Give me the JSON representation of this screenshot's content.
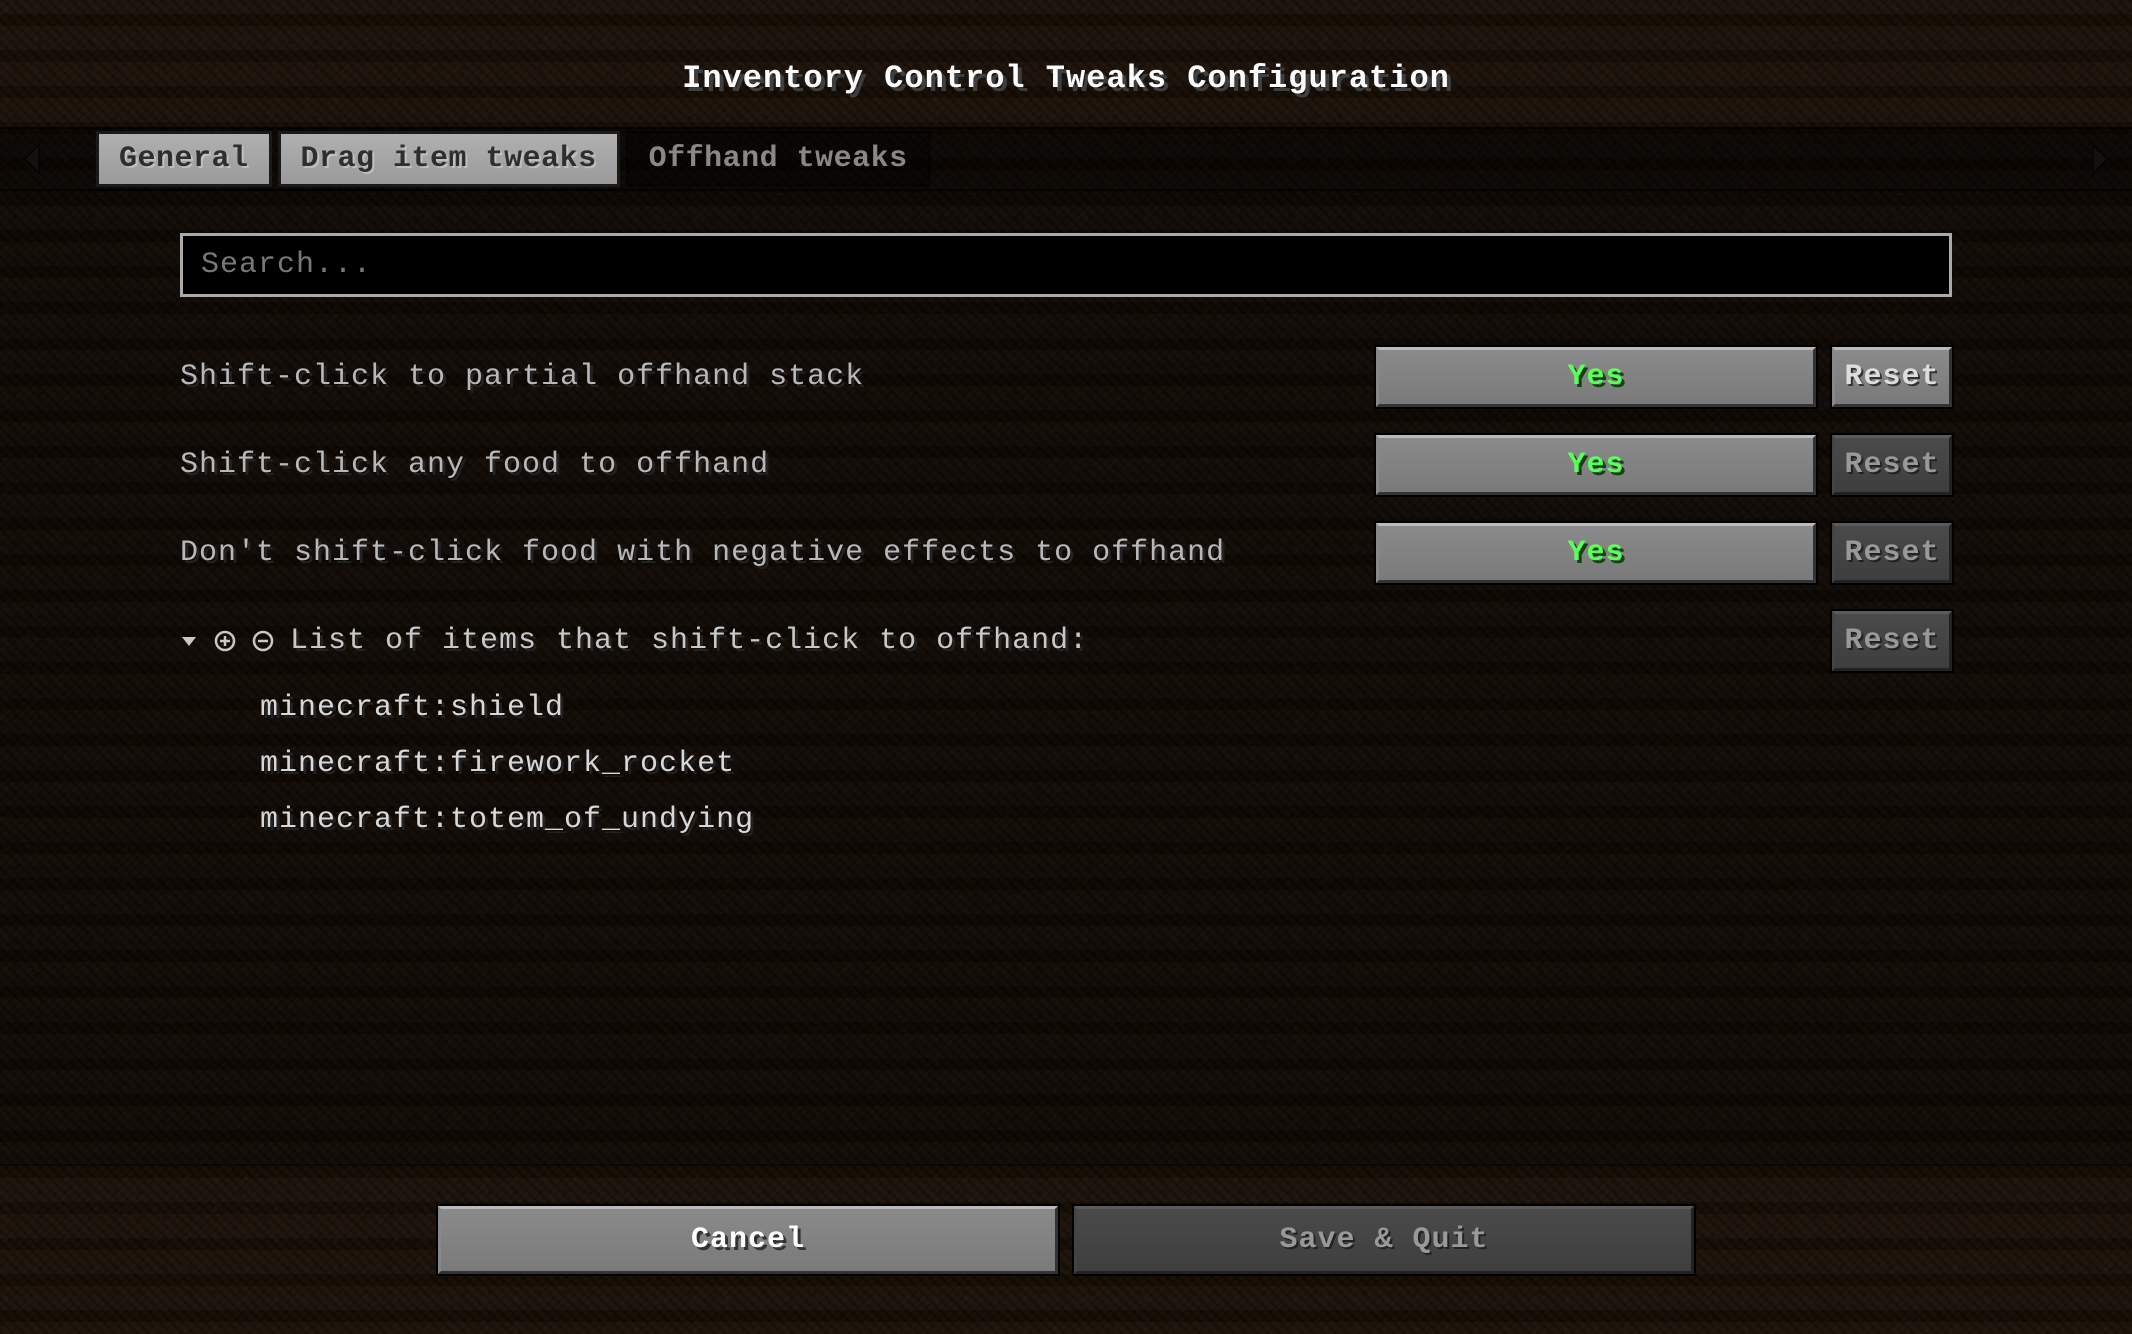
{
  "title": "Inventory Control Tweaks Configuration",
  "tabs": {
    "general": "General",
    "drag": "Drag item tweaks",
    "offhand": "Offhand tweaks"
  },
  "search": {
    "placeholder": "Search...",
    "value": ""
  },
  "options": {
    "opt0": {
      "label": "Shift-click to partial offhand stack",
      "value": "Yes",
      "reset": "Reset"
    },
    "opt1": {
      "label": "Shift-click any food to offhand",
      "value": "Yes",
      "reset": "Reset"
    },
    "opt2": {
      "label": "Don't shift-click food with negative effects to offhand",
      "value": "Yes",
      "reset": "Reset"
    }
  },
  "list": {
    "label": "List of items that shift-click to offhand:",
    "reset": "Reset",
    "items": {
      "i0": "minecraft:shield",
      "i1": "minecraft:firework_rocket",
      "i2": "minecraft:totem_of_undying"
    }
  },
  "footer": {
    "cancel": "Cancel",
    "save": "Save & Quit"
  }
}
